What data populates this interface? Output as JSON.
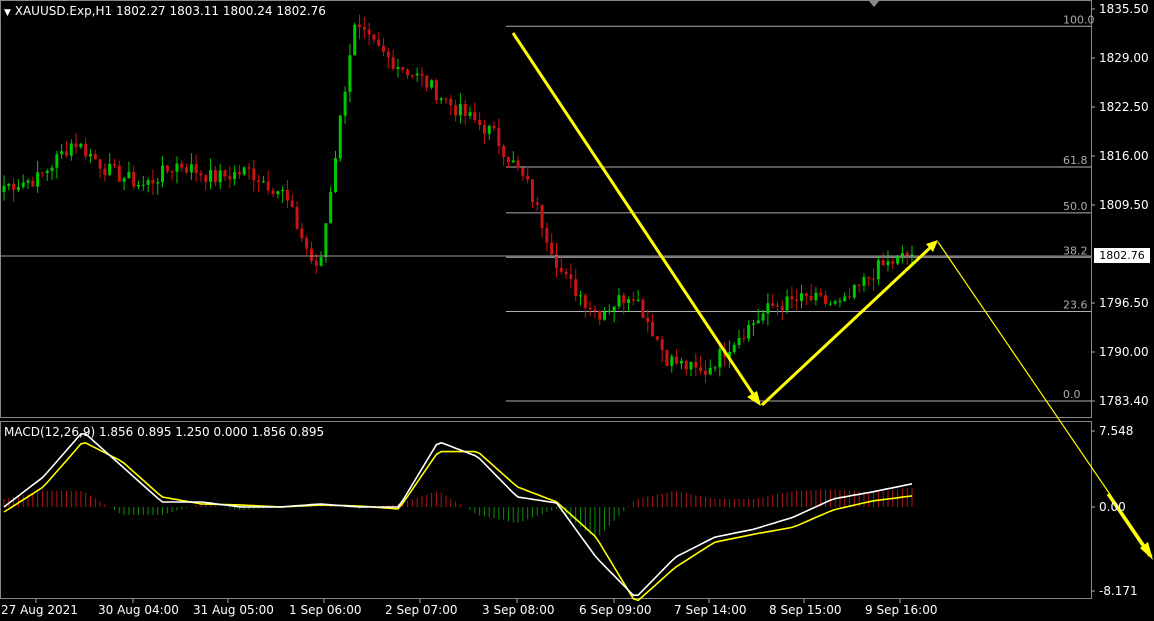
{
  "header": {
    "symbol_line": "XAUUSD.Exp,H1  1802.27 1803.11 1800.24 1802.76",
    "macd_line": "MACD(12,26,9) 1.856 0.895 1.250 0.000 1.856 0.895"
  },
  "price_tag": "1802.76",
  "colors": {
    "bull": "#00c800",
    "bear": "#c81414",
    "arrow": "#ffff00",
    "macd_main": "#ffffff",
    "macd_signal": "#ffff00",
    "hist_pos": "#b41414",
    "hist_neg": "#0a8c0a",
    "grid": "#b0b0b0"
  },
  "chart_data": {
    "type": "candlestick",
    "price_axis": {
      "ticks": [
        "1835.50",
        "1829.00",
        "1822.50",
        "1816.00",
        "1809.50",
        "1802.76",
        "1796.50",
        "1790.00",
        "1783.40"
      ]
    },
    "macd_axis": {
      "ticks": [
        "7.548",
        "0.00",
        "-8.171"
      ]
    },
    "time_axis": [
      "27 Aug 2021",
      "30 Aug 04:00",
      "31 Aug 05:00",
      "1 Sep 06:00",
      "2 Sep 07:00",
      "3 Sep 08:00",
      "6 Sep 09:00",
      "7 Sep 14:00",
      "8 Sep 15:00",
      "9 Sep 16:00"
    ],
    "fibonacci": [
      {
        "label": "100.0",
        "price": 1833.2
      },
      {
        "label": "61.8",
        "price": 1814.5
      },
      {
        "label": "50.0",
        "price": 1808.4
      },
      {
        "label": "38.2",
        "price": 1802.5
      },
      {
        "label": "23.6",
        "price": 1795.3
      },
      {
        "label": "0.0",
        "price": 1783.4
      }
    ],
    "key_prices": [
      1812,
      1813,
      1818,
      1814,
      1812,
      1815,
      1813,
      1814,
      1811,
      1800,
      1833,
      1829,
      1826,
      1822,
      1819,
      1812,
      1800,
      1795,
      1798,
      1789,
      1787,
      1792,
      1796,
      1797,
      1796,
      1801,
      1803
    ]
  }
}
